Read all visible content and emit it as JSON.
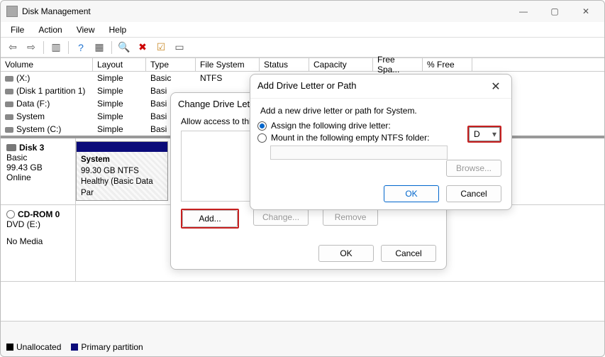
{
  "window": {
    "app_title": "Disk Management",
    "menu": [
      "File",
      "Action",
      "View",
      "Help"
    ]
  },
  "columns": {
    "volume": "Volume",
    "layout": "Layout",
    "type": "Type",
    "fs": "File System",
    "status": "Status",
    "capacity": "Capacity",
    "free": "Free Spa...",
    "pct": "% Free"
  },
  "volumes": [
    {
      "name": "(X:)",
      "layout": "Simple",
      "type": "Basic",
      "fs": "NTFS"
    },
    {
      "name": "(Disk 1 partition 1)",
      "layout": "Simple",
      "type": "Basi"
    },
    {
      "name": "Data (F:)",
      "layout": "Simple",
      "type": "Basi"
    },
    {
      "name": "System",
      "layout": "Simple",
      "type": "Basi"
    },
    {
      "name": "System (C:)",
      "layout": "Simple",
      "type": "Basi"
    }
  ],
  "disk3": {
    "title": "Disk 3",
    "type": "Basic",
    "size": "99.43 GB",
    "status": "Online",
    "part_name": "System",
    "part_size": "99.30 GB NTFS",
    "part_status": "Healthy (Basic Data Par"
  },
  "cdrom": {
    "title": "CD-ROM 0",
    "type": "DVD (E:)",
    "status": "No Media"
  },
  "legend": {
    "unalloc": "Unallocated",
    "primary": "Primary partition"
  },
  "dialog1": {
    "title": "Change Drive Lette",
    "text": "Allow access to this v",
    "add": "Add...",
    "change": "Change...",
    "remove": "Remove",
    "ok": "OK",
    "cancel": "Cancel"
  },
  "dialog2": {
    "title": "Add Drive Letter or Path",
    "intro": "Add a new drive letter or path for System.",
    "opt_assign": "Assign the following drive letter:",
    "opt_mount": "Mount in the following empty NTFS folder:",
    "letter": "D",
    "browse": "Browse...",
    "ok": "OK",
    "cancel": "Cancel"
  }
}
